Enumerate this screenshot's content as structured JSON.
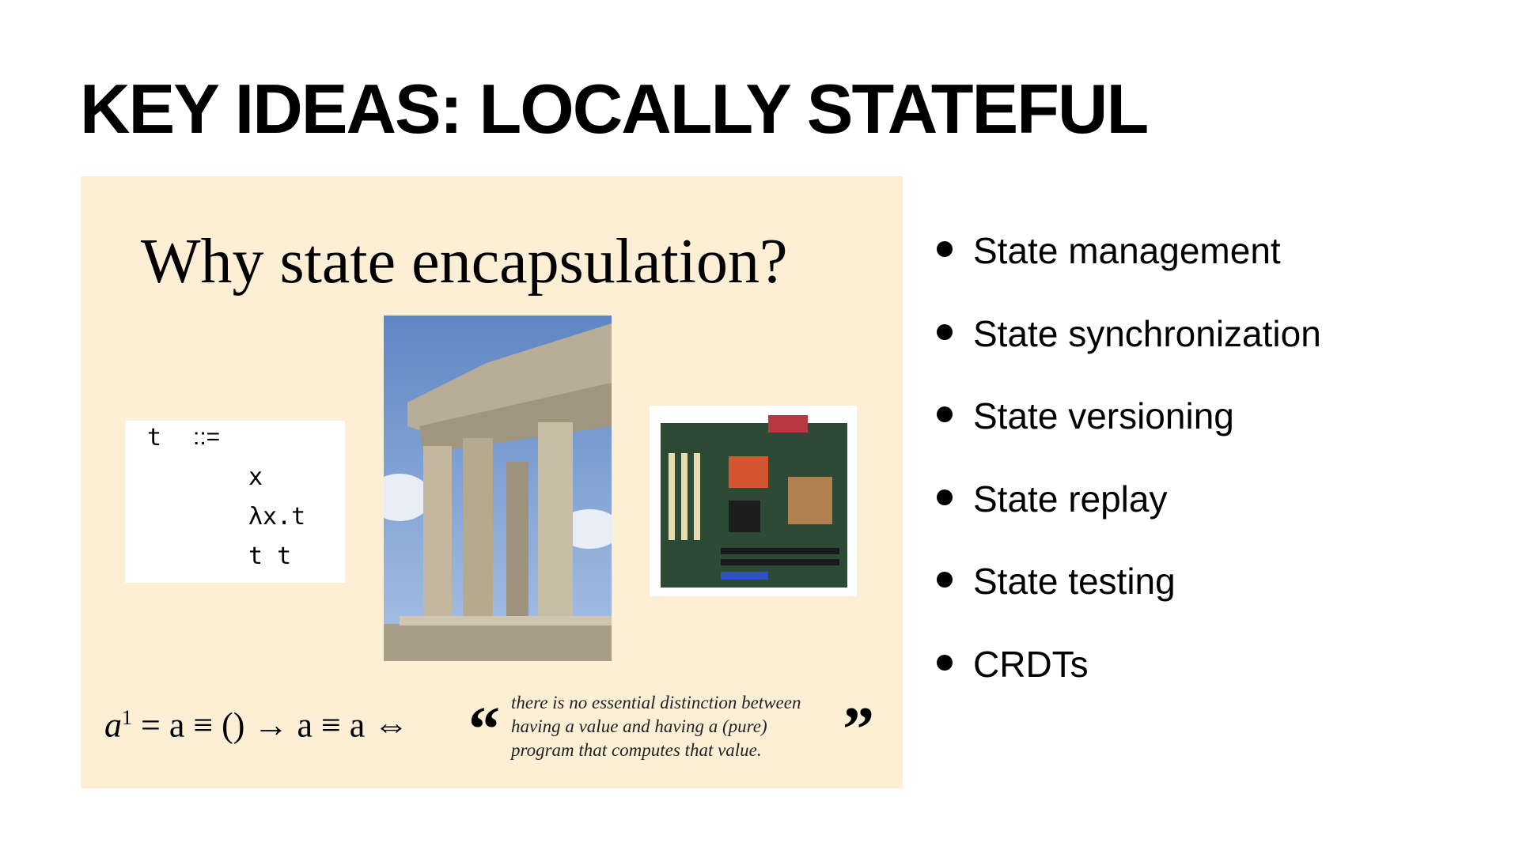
{
  "slide": {
    "title": "KEY IDEAS: LOCALLY STATEFUL",
    "panel": {
      "heading": "Why state encapsulation?",
      "grammar": {
        "lhs": "t",
        "op": "::=",
        "productions": [
          "x",
          "λx.t",
          "t t"
        ]
      },
      "images": [
        "parthenon-photo",
        "motherboard-photo"
      ],
      "equation": {
        "base": "a",
        "exponent": "1",
        "rest": "= a ≡ () → a ≡ a ⇔"
      },
      "quote": {
        "open": "“",
        "close": "”",
        "lines": [
          "there is no essential distinction between",
          "having a value and having a (pure)",
          "program that computes that value."
        ]
      },
      "background": "#fcefd6"
    },
    "bullets": [
      "State management",
      "State synchronization",
      "State versioning",
      "State replay",
      "State testing",
      "CRDTs"
    ]
  }
}
